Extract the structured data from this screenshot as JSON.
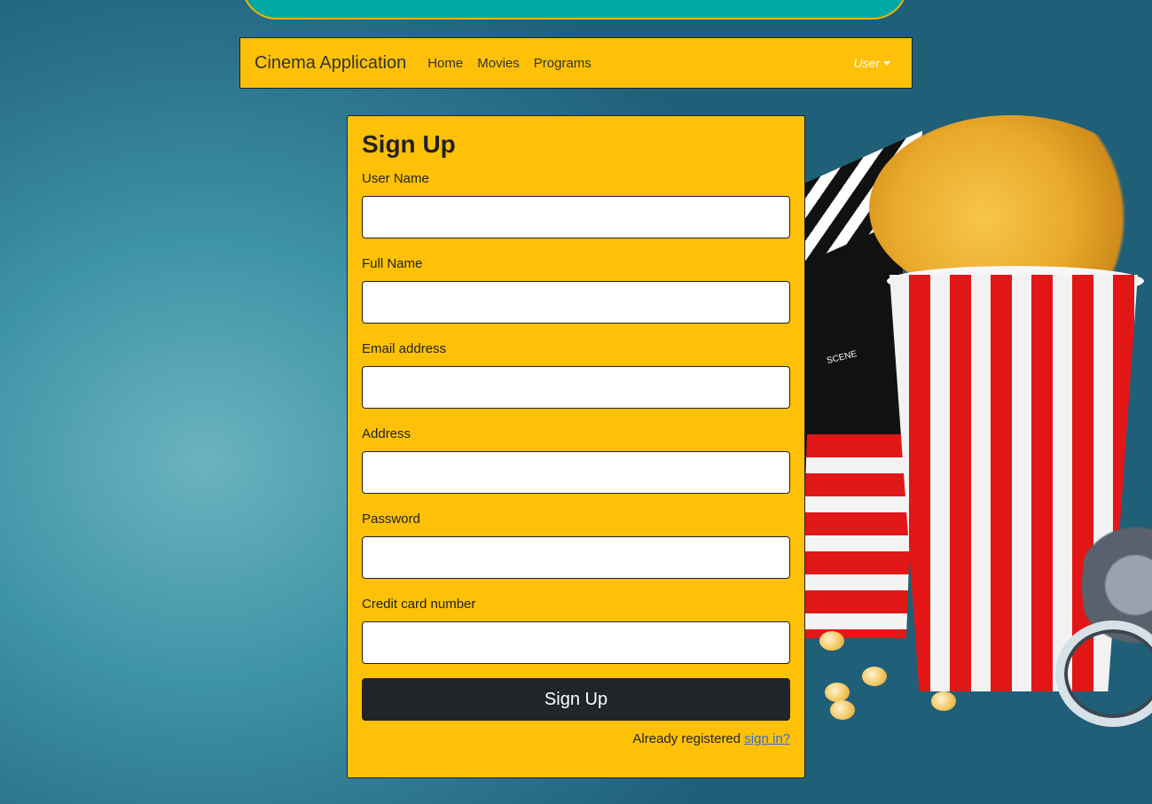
{
  "navbar": {
    "brand": "Cinema Application",
    "links": [
      "Home",
      "Movies",
      "Programs"
    ],
    "user_menu": "User"
  },
  "signup": {
    "title": "Sign Up",
    "fields": [
      {
        "label": "User Name",
        "value": ""
      },
      {
        "label": "Full Name",
        "value": ""
      },
      {
        "label": "Email address",
        "value": ""
      },
      {
        "label": "Address",
        "value": ""
      },
      {
        "label": "Password",
        "value": ""
      },
      {
        "label": "Credit card number",
        "value": ""
      }
    ],
    "submit_label": "Sign Up",
    "already_text": "Already registered",
    "signin_link": "sign in?"
  },
  "decor": {
    "scene_text": "SCENE"
  },
  "colors": {
    "accent": "#ffc107",
    "button": "#212529",
    "banner": "#00a9a5"
  }
}
